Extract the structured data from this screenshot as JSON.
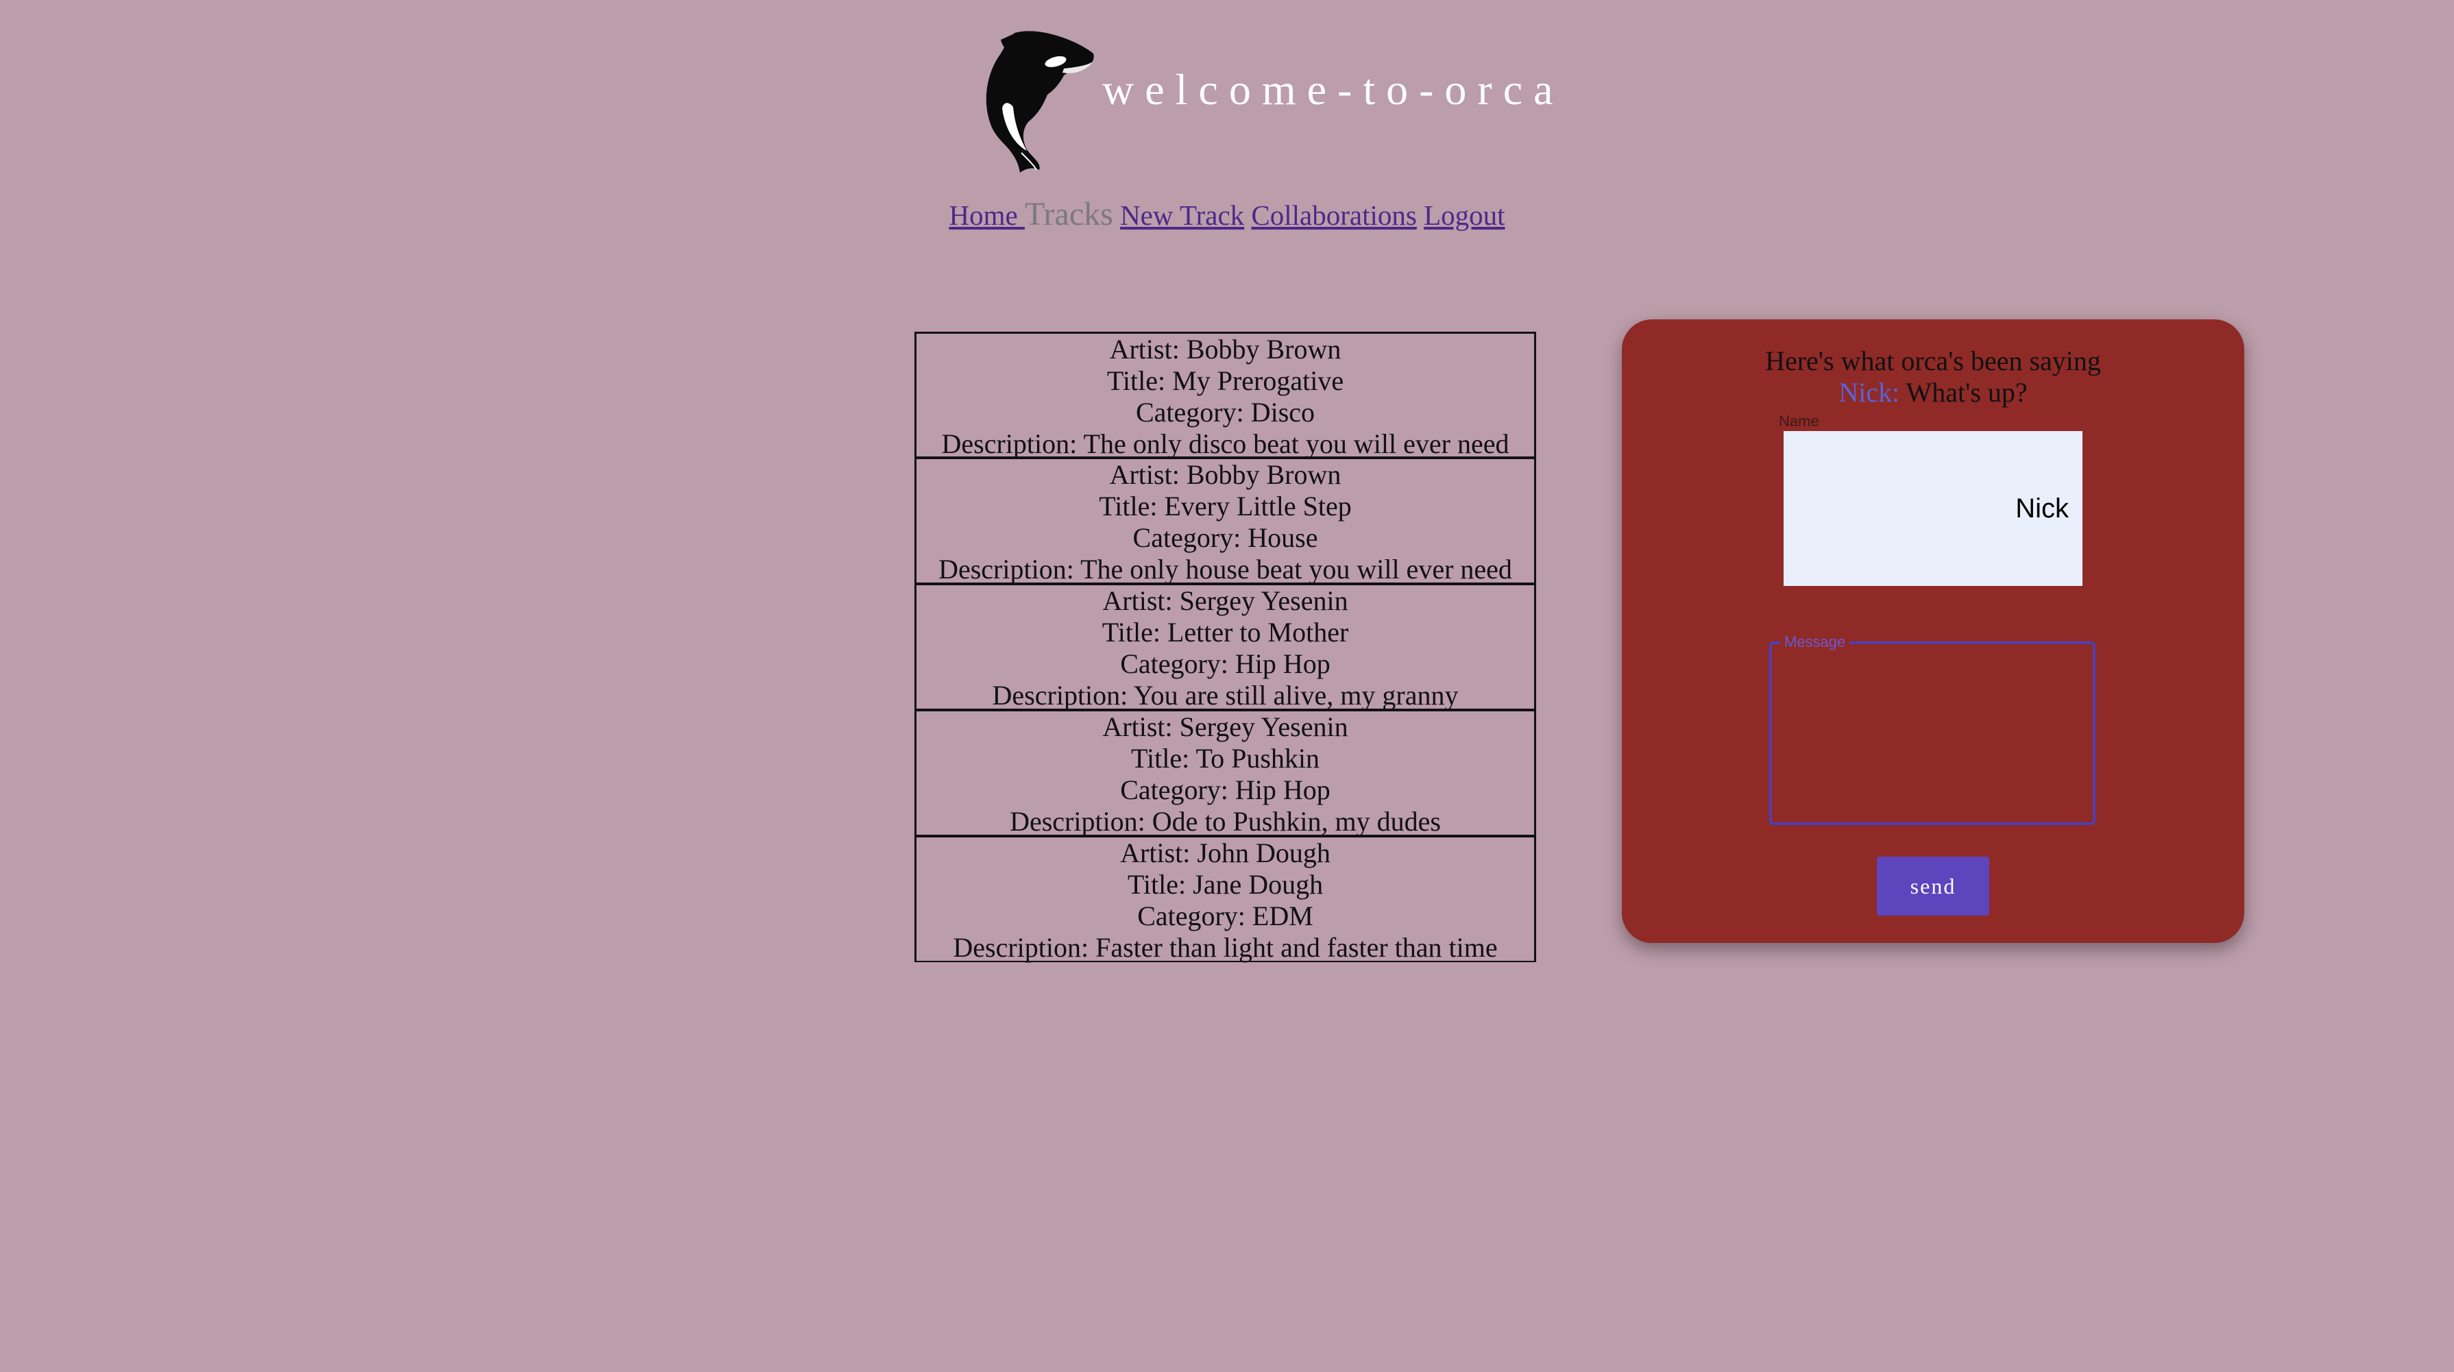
{
  "header": {
    "title": "welcome-to-orca",
    "logo_icon": "orca-logo-icon"
  },
  "nav": {
    "home": "Home ",
    "tracks": "Tracks",
    "new_track": "New Track",
    "collaborations": "Collaborations",
    "logout": "Logout"
  },
  "tracks": [
    {
      "artist": "Artist: Bobby Brown",
      "title": "Title: My Prerogative",
      "category": "Category: Disco",
      "description": "Description: The only disco beat you will ever need"
    },
    {
      "artist": "Artist: Bobby Brown",
      "title": "Title: Every Little Step",
      "category": "Category: House",
      "description": "Description: The only house beat you will ever need"
    },
    {
      "artist": "Artist: Sergey Yesenin",
      "title": "Title: Letter to Mother",
      "category": "Category: Hip Hop",
      "description": "Description: You are still alive, my granny"
    },
    {
      "artist": "Artist: Sergey Yesenin",
      "title": "Title: To Pushkin",
      "category": "Category: Hip Hop",
      "description": "Description: Ode to Pushkin, my dudes"
    },
    {
      "artist": "Artist: John Dough",
      "title": "Title: Jane Dough",
      "category": "Category: EDM",
      "description": "Description: Faster than light and faster than time"
    }
  ],
  "chat": {
    "heading": "Here's what orca's been saying",
    "messages": [
      {
        "user": "Nick:",
        "text": " What's up?"
      }
    ],
    "name_label": "Name",
    "name_value": "Nick",
    "message_label": "Message",
    "message_value": "",
    "send_label": "send"
  },
  "colors": {
    "background": "#bc9daa",
    "chat_card": "#8f2a27",
    "accent": "#5c45bd",
    "link": "#4b2a8a",
    "username": "#5b63d8"
  }
}
